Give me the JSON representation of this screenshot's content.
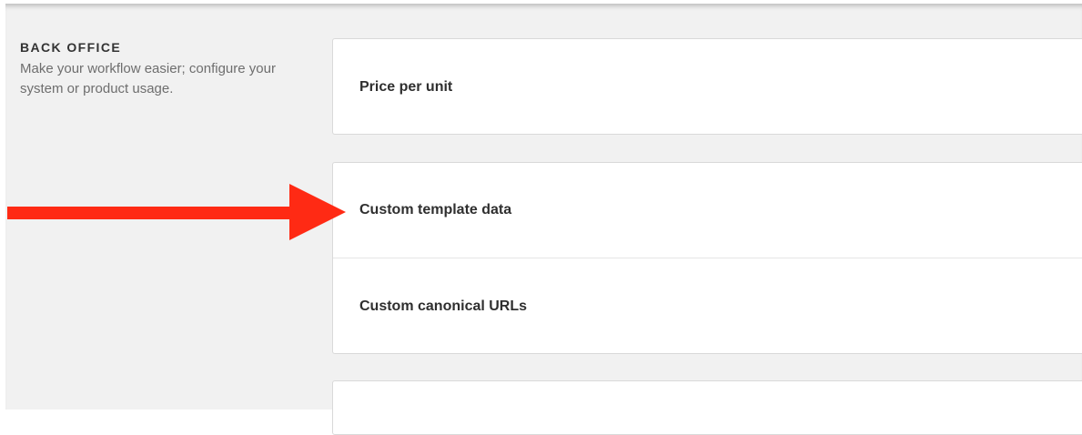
{
  "section": {
    "title": "BACK OFFICE",
    "description": "Make your workflow easier; configure your system or product usage."
  },
  "settings": [
    {
      "label": "Price per unit"
    },
    {
      "label": "Custom template data"
    },
    {
      "label": "Custom canonical URLs"
    }
  ],
  "annotation": {
    "icon": "arrow-right-icon",
    "color": "#ff2a14"
  }
}
